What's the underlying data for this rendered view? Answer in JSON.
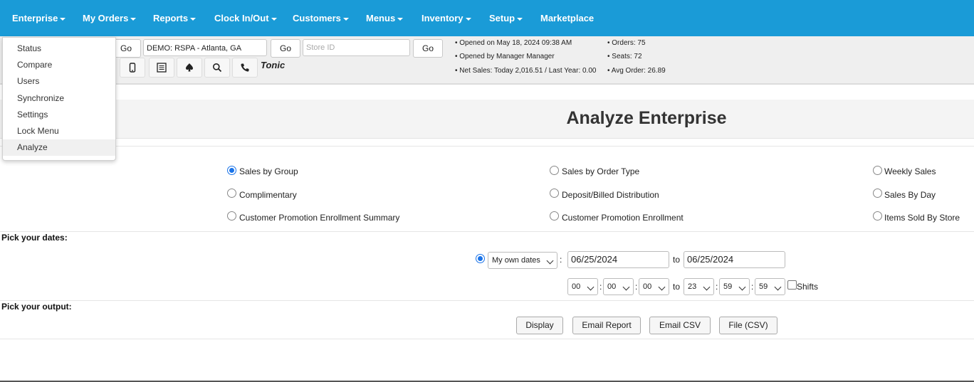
{
  "nav": {
    "items": [
      {
        "label": "Enterprise",
        "caret": true
      },
      {
        "label": "My Orders",
        "caret": true
      },
      {
        "label": "Reports",
        "caret": true
      },
      {
        "label": "Clock In/Out",
        "caret": true
      },
      {
        "label": "Customers",
        "caret": true
      },
      {
        "label": "Menus",
        "caret": true
      },
      {
        "label": "Inventory",
        "caret": true
      },
      {
        "label": "Setup",
        "caret": true
      },
      {
        "label": "Marketplace",
        "caret": false
      }
    ],
    "color": "#1a9bd7"
  },
  "enterprise_menu": {
    "items": [
      "Status",
      "Compare",
      "Users",
      "Synchronize",
      "Settings",
      "Lock Menu",
      "Analyze"
    ],
    "active": "Analyze"
  },
  "toolbar": {
    "go1": "Go",
    "store_name": "DEMO: RSPA - Atlanta, GA",
    "go2": "Go",
    "store_id_placeholder": "Store ID",
    "go3": "Go",
    "brand_text": "Tonic",
    "icons": [
      "mobile-icon",
      "list-icon",
      "spade-icon",
      "search-icon",
      "phone-icon"
    ]
  },
  "store_info": {
    "opened_on": "• Opened on May 18, 2024 09:38 AM",
    "opened_by": "• Opened by Manager Manager",
    "net_sales": "• Net Sales: Today 2,016.51 / Last Year: 0.00",
    "orders": "• Orders: 75",
    "seats": "• Seats: 72",
    "avg_order": "• Avg Order: 26.89"
  },
  "page": {
    "title": "Analyze Enterprise"
  },
  "reports": {
    "options": [
      {
        "label": "Sales by Group",
        "selected": true
      },
      {
        "label": "Sales by Order Type",
        "selected": false
      },
      {
        "label": "Weekly Sales",
        "selected": false
      },
      {
        "label": "Complimentary",
        "selected": false
      },
      {
        "label": "Deposit/Billed Distribution",
        "selected": false
      },
      {
        "label": "Sales By Day",
        "selected": false
      },
      {
        "label": "Customer Promotion Enrollment Summary",
        "selected": false
      },
      {
        "label": "Customer Promotion Enrollment",
        "selected": false
      },
      {
        "label": "Items Sold By Store",
        "selected": false
      }
    ]
  },
  "dates": {
    "section_label": "Pick your dates:",
    "range_type": "My own dates",
    "colon": ":",
    "from": "06/25/2024",
    "to_label": "to",
    "to": "06/25/2024",
    "start_time": {
      "h": "00",
      "m": "00",
      "s": "00"
    },
    "end_time": {
      "h": "23",
      "m": "59",
      "s": "59"
    },
    "shifts_label": "Shifts"
  },
  "output": {
    "section_label": "Pick your output:",
    "buttons": [
      "Display",
      "Email Report",
      "Email CSV",
      "File (CSV)"
    ]
  }
}
